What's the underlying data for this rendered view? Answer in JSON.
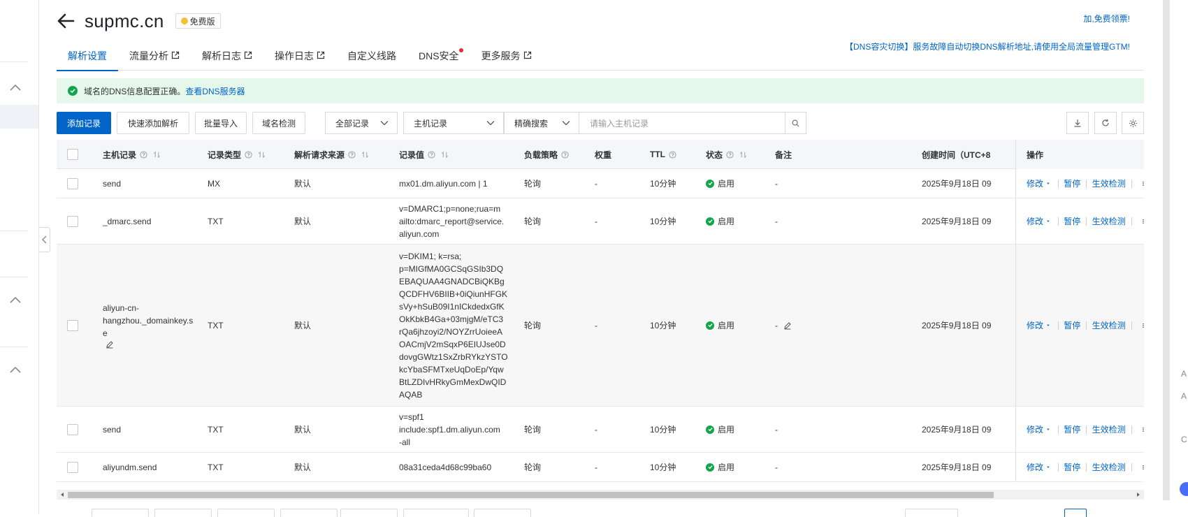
{
  "header": {
    "domain": "supmc.cn",
    "badge": "免费版"
  },
  "top_link": "加,免费领票!",
  "dns_notice": "【DNS容灾切换】服务故障自动切换DNS解析地址,请使用全局流量管理GTM!",
  "tabs": [
    {
      "label": "解析设置",
      "active": true,
      "external": false
    },
    {
      "label": "流量分析",
      "external": true
    },
    {
      "label": "解析日志",
      "external": true
    },
    {
      "label": "操作日志",
      "external": true
    },
    {
      "label": "自定义线路",
      "external": false
    },
    {
      "label": "DNS安全",
      "external": false,
      "dot": true
    },
    {
      "label": "更多服务",
      "external": true
    }
  ],
  "alert": {
    "text": "域名的DNS信息配置正确。",
    "link": "查看DNS服务器"
  },
  "toolbar": {
    "add": "添加记录",
    "quick_add": "快速添加解析",
    "batch_import": "批量导入",
    "domain_check": "域名检测",
    "filter_records": "全部记录",
    "search_field": "主机记录",
    "match_mode": "精确搜索",
    "search_placeholder": "请输入主机记录"
  },
  "columns": {
    "host": "主机记录",
    "type": "记录类型",
    "source": "解析请求来源",
    "value": "记录值",
    "policy": "负载策略",
    "weight": "权重",
    "ttl": "TTL",
    "status": "状态",
    "remark": "备注",
    "created": "创建时间（UTC+8",
    "ops": "操作"
  },
  "records": [
    {
      "host": "send",
      "type": "MX",
      "source": "默认",
      "value": "mx01.dm.aliyun.com | 1",
      "policy": "轮询",
      "weight": "-",
      "ttl": "10分钟",
      "status": "启用",
      "remark": "-",
      "created": "2025年9月18日 09"
    },
    {
      "host": "_dmarc.send",
      "type": "TXT",
      "source": "默认",
      "value": "v=DMARC1;p=none;rua=m\nailto:dmarc_report@service.\naliyun.com",
      "policy": "轮询",
      "weight": "-",
      "ttl": "10分钟",
      "status": "启用",
      "remark": "-",
      "created": "2025年9月18日 09"
    },
    {
      "host": "aliyun-cn-\nhangzhou._domainkey.se",
      "type": "TXT",
      "source": "默认",
      "value": "v=DKIM1; k=rsa;\np=MIGfMA0GCSqGSIb3DQ\nEBAQUAA4GNADCBiQKBg\nQCDFHV6BIIB+0iQiunHFGK\nsVy+hSuB09I1nICkdedxGfK\nOkKbkB4Ga+03mjgM/eTC3\nrQa6jhzoyi2/NOYZrrUoieeA\nOACmjV2mSqxP6EIUJse0D\ndovgGWtz1SxZrbRYkzYSTO\nkcYbaSFMTxeUqDoEp/Yqw\nBtLZDIvHRkyGmMexDwQID\nAQAB",
      "policy": "轮询",
      "weight": "-",
      "ttl": "10分钟",
      "status": "启用",
      "remark": "-",
      "created": "2025年9月18日 09"
    },
    {
      "host": "send",
      "type": "TXT",
      "source": "默认",
      "value": "v=spf1\ninclude:spf1.dm.aliyun.com\n-all",
      "policy": "轮询",
      "weight": "-",
      "ttl": "10分钟",
      "status": "启用",
      "remark": "-",
      "created": "2025年9月18日 09"
    },
    {
      "host": "aliyundm.send",
      "type": "TXT",
      "source": "默认",
      "value": "08a31ceda4d68c99ba60",
      "policy": "轮询",
      "weight": "-",
      "ttl": "10分钟",
      "status": "启用",
      "remark": "-",
      "created": "2025年9月18日 09"
    }
  ],
  "row_ops": {
    "edit": "修改",
    "pause": "暂停",
    "check": "生效检测"
  },
  "edge_fragments": [
    "A",
    "A",
    "C"
  ],
  "colors": {
    "accent": "#0064c8",
    "success": "#14a44d",
    "alert_bg": "#e6f7ec",
    "header_bg": "#f5f6fa",
    "red_dot": "#e62e2e"
  }
}
